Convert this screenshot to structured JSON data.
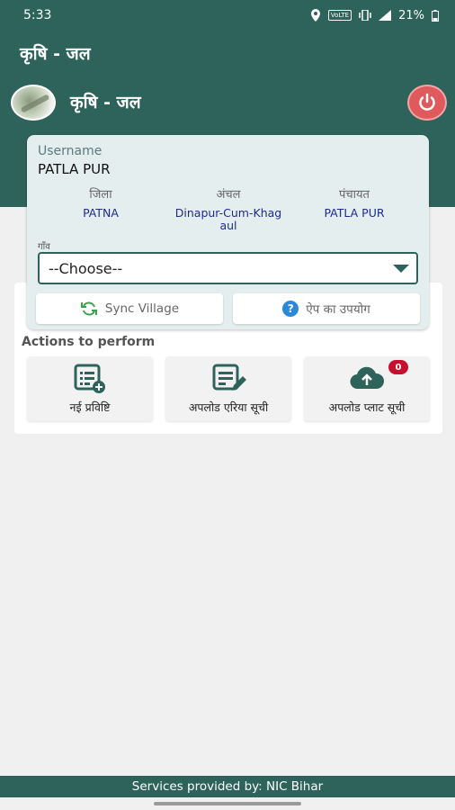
{
  "status_bar": {
    "time": "5:33",
    "network": "VoLTE",
    "battery": "21%"
  },
  "app_bar": {
    "title": "कृषि - जल"
  },
  "header": {
    "app_name": "कृषि - जल"
  },
  "user": {
    "username_label": "Username",
    "username": "PATLA PUR",
    "district_label": "जिला",
    "district": "PATNA",
    "block_label": "अंचल",
    "block": "Dinapur-Cum-Khag aul",
    "panchayat_label": "पंचायत",
    "panchayat": "PATLA PUR"
  },
  "village": {
    "label": "गाँव",
    "selected": "--Choose--"
  },
  "buttons": {
    "sync_village": "Sync Village",
    "app_usage": "ऐप का उपयोग"
  },
  "actions": {
    "title": "Actions to perform",
    "items": [
      {
        "label": "नई प्रविष्टि",
        "icon": "new-entry-icon"
      },
      {
        "label": "अपलोड एरिया सूची",
        "icon": "edit-list-icon"
      },
      {
        "label": "अपलोड प्लाट सूची",
        "icon": "cloud-upload-icon",
        "badge": "0"
      }
    ]
  },
  "footer": {
    "text": "Services provided by: NIC Bihar"
  },
  "colors": {
    "primary": "#2e635c",
    "accent_red": "#e0595c",
    "badge_red": "#c8102e",
    "link_blue": "#1e2a8c"
  }
}
